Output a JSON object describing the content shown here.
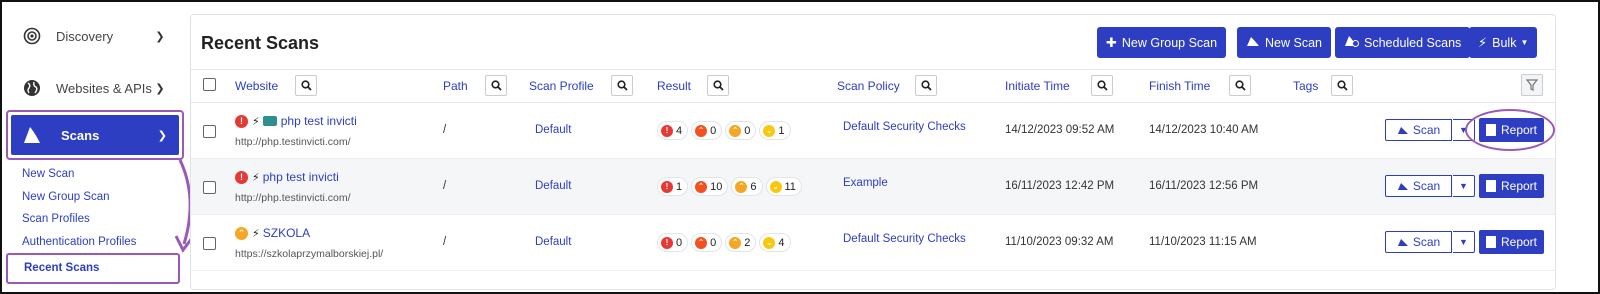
{
  "sidebar": {
    "discovery_label": "Discovery",
    "websites_label": "Websites & APIs",
    "scans_label": "Scans",
    "sub_items": [
      "New Scan",
      "New Group Scan",
      "Scan Profiles",
      "Authentication Profiles"
    ],
    "recent_scans_label": "Recent Scans"
  },
  "header": {
    "title": "Recent Scans",
    "buttons": {
      "new_group_scan": "New Group Scan",
      "new_scan": "New Scan",
      "scheduled_scans": "Scheduled Scans",
      "bulk": "Bulk"
    }
  },
  "table": {
    "columns": {
      "website": "Website",
      "path": "Path",
      "scan_profile": "Scan Profile",
      "result": "Result",
      "scan_policy": "Scan Policy",
      "initiate_time": "Initiate Time",
      "finish_time": "Finish Time",
      "tags": "Tags"
    },
    "rows": [
      {
        "name": "php test invicti",
        "url": "http://php.testinvicti.com/",
        "path": "/",
        "profile": "Default",
        "critical": "4",
        "high": "0",
        "medium": "0",
        "low": "1",
        "policy": "Default Security Checks",
        "initiated": "14/12/2023 09:52 AM",
        "finished": "14/12/2023 10:40 AM",
        "scan_label": "Scan",
        "report_label": "Report"
      },
      {
        "name": "php test invicti",
        "url": "http://php.testinvicti.com/",
        "path": "/",
        "profile": "Default",
        "critical": "1",
        "high": "10",
        "medium": "6",
        "low": "11",
        "policy": "Example",
        "initiated": "16/11/2023 12:42 PM",
        "finished": "16/11/2023 12:56 PM",
        "scan_label": "Scan",
        "report_label": "Report"
      },
      {
        "name": "SZKOLA",
        "url": "https://szkolaprzymalborskiej.pl/",
        "path": "/",
        "profile": "Default",
        "critical": "0",
        "high": "0",
        "medium": "2",
        "low": "4",
        "policy": "Default Security Checks",
        "initiated": "11/10/2023 09:32 AM",
        "finished": "11/10/2023 11:15 AM",
        "scan_label": "Scan",
        "report_label": "Report"
      }
    ]
  },
  "colors": {
    "primary": "#2d3ec2",
    "highlight": "#9b59b6",
    "critical": "#e53935",
    "high": "#f4511e",
    "medium": "#f5a623",
    "low": "#f9c80e"
  }
}
